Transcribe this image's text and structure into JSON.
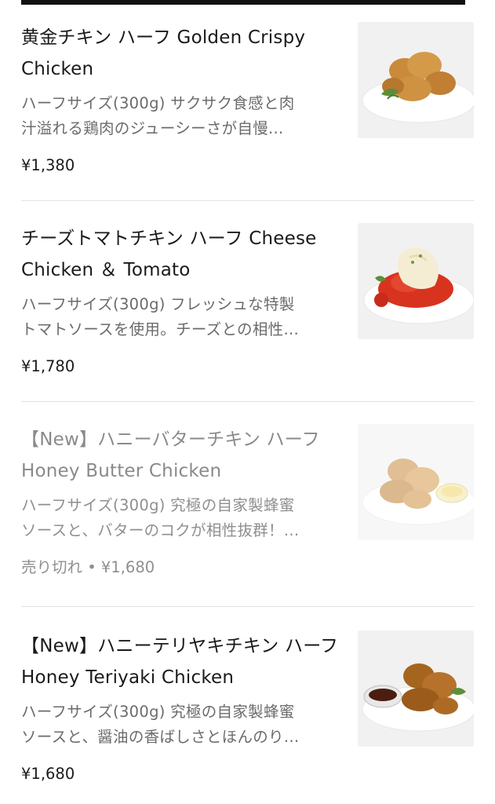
{
  "menu_items": [
    {
      "title": "黄金チキン ハーフ Golden Crispy Chicken",
      "description": "ハーフサイズ(300g) サクサク食感と肉\n汁溢れる鶏肉のジューシーさが自慢...",
      "price": "¥1,380",
      "image_icon": "golden-crispy-chicken-photo",
      "sold_out": false
    },
    {
      "title": "チーズトマトチキン ハーフ Cheese Chicken ＆ Tomato",
      "description": "ハーフサイズ(300g) フレッシュな特製\nトマトソースを使用。チーズとの相性...",
      "price": "¥1,780",
      "image_icon": "cheese-tomato-chicken-photo",
      "sold_out": false
    },
    {
      "title": "【New】ハニーバターチキン ハーフ Honey Butter Chicken",
      "description": "ハーフサイズ(300g) 究極の自家製蜂蜜\nソースと、バターのコクが相性抜群！...",
      "price": "売り切れ • ¥1,680",
      "image_icon": "honey-butter-chicken-photo",
      "sold_out": true
    },
    {
      "title": "【New】ハニーテリヤキチキン ハーフ Honey Teriyaki Chicken",
      "description": "ハーフサイズ(300g) 究極の自家製蜂蜜\nソースと、醤油の香ばしさとほんのり...",
      "price": "¥1,680",
      "image_icon": "honey-teriyaki-chicken-photo",
      "sold_out": false
    }
  ],
  "colors": {
    "text": "#1a1a1a",
    "description": "#6b6b6b",
    "sold_out_text": "#8f8f8f",
    "divider": "#e2e2e2",
    "top_bar": "#111111"
  }
}
